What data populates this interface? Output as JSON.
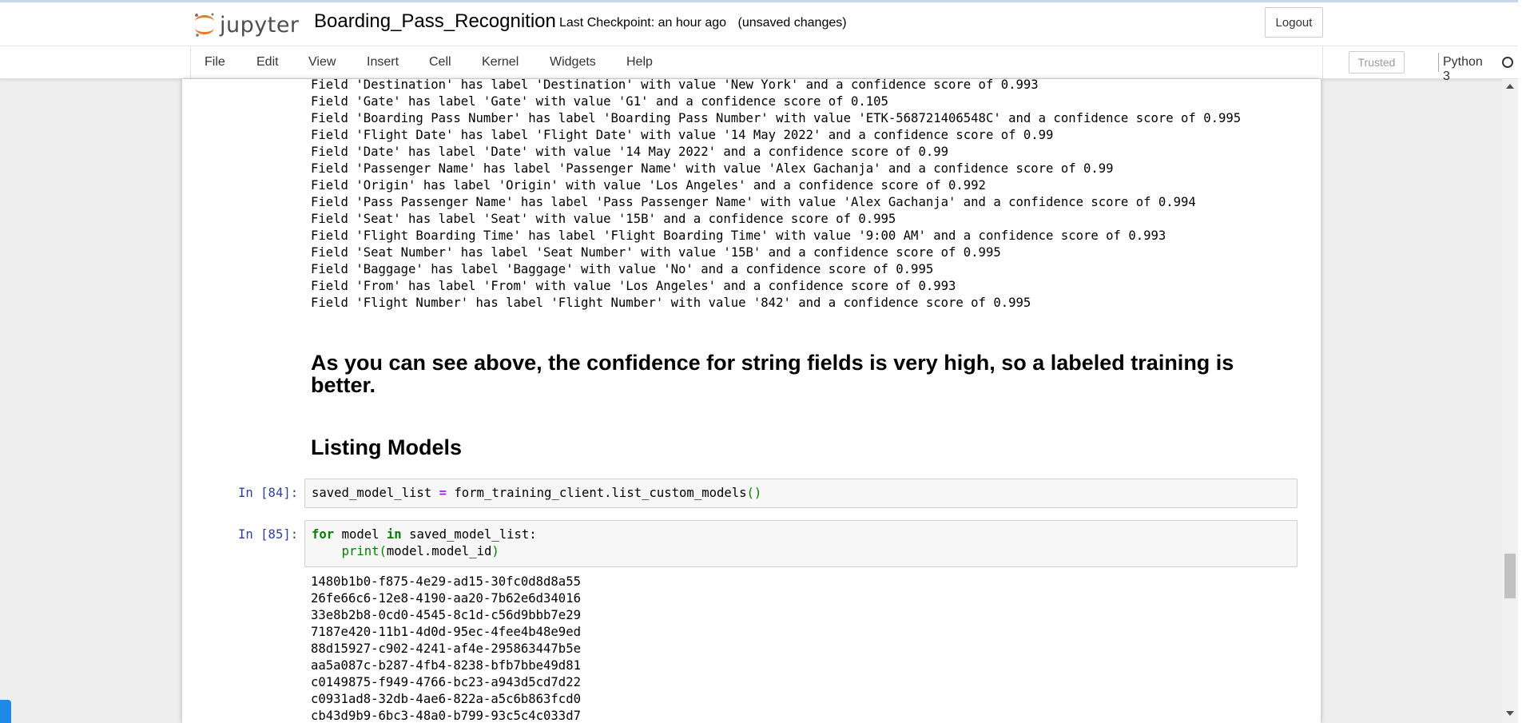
{
  "header": {
    "logo_text": "jupyter",
    "notebook_title": "Boarding_Pass_Recognition",
    "checkpoint_text": "Last Checkpoint: an hour ago",
    "unsaved_text": "(unsaved changes)",
    "logout_label": "Logout"
  },
  "menu": {
    "items": [
      "File",
      "Edit",
      "View",
      "Insert",
      "Cell",
      "Kernel",
      "Widgets",
      "Help"
    ],
    "trusted_label": "Trusted",
    "kernel_label": "Python 3"
  },
  "output_fields": [
    "Field 'Destination' has label 'Destination' with value 'New York' and a confidence score of 0.993",
    "Field 'Gate' has label 'Gate' with value 'G1' and a confidence score of 0.105",
    "Field 'Boarding Pass Number' has label 'Boarding Pass Number' with value 'ETK-568721406548C' and a confidence score of 0.995",
    "Field 'Flight Date' has label 'Flight Date' with value '14 May 2022' and a confidence score of 0.99",
    "Field 'Date' has label 'Date' with value '14 May 2022' and a confidence score of 0.99",
    "Field 'Passenger Name' has label 'Passenger Name' with value 'Alex Gachanja' and a confidence score of 0.99",
    "Field 'Origin' has label 'Origin' with value 'Los Angeles' and a confidence score of 0.992",
    "Field 'Pass Passenger Name' has label 'Pass Passenger Name' with value 'Alex Gachanja' and a confidence score of 0.994",
    "Field 'Seat' has label 'Seat' with value '15B' and a confidence score of 0.995",
    "Field 'Flight Boarding Time' has label 'Flight Boarding Time' with value '9:00 AM' and a confidence score of 0.993",
    "Field 'Seat Number' has label 'Seat Number' with value '15B' and a confidence score of 0.995",
    "Field 'Baggage' has label 'Baggage' with value 'No' and a confidence score of 0.995",
    "Field 'From' has label 'From' with value 'Los Angeles' and a confidence score of 0.993",
    "Field 'Flight Number' has label 'Flight Number' with value '842' and a confidence score of 0.995"
  ],
  "markdown": {
    "note": "As you can see above, the confidence for string fields is very high, so a labeled training is better.",
    "heading": "Listing Models"
  },
  "cell84": {
    "prompt": "In [84]:",
    "var": "saved_model_list",
    "op": "=",
    "call": "form_training_client.list_custom_models",
    "parens": "()"
  },
  "cell85": {
    "prompt": "In [85]:",
    "kw_for": "for",
    "var_model": "model",
    "kw_in": "in",
    "iter": "saved_model_list:",
    "builtin_print": "print",
    "open_paren": "(",
    "arg": "model.model_id",
    "close_paren": ")"
  },
  "model_ids": [
    "1480b1b0-f875-4e29-ad15-30fc0d8d8a55",
    "26fe66c6-12e8-4190-aa20-7b62e6d34016",
    "33e8b2b8-0cd0-4545-8c1d-c56d9bbb7e29",
    "7187e420-11b1-4d0d-95ec-4fee4b48e9ed",
    "88d15927-c902-4241-af4e-295863447b5e",
    "aa5a087c-b287-4fb4-8238-bfb7bbe49d81",
    "c0149875-f949-4766-bc23-a943d5cd7d22",
    "c0931ad8-32db-4ae6-822a-a5c6b863fcd0",
    "cb43d9b9-6bc3-48a0-b799-93c5c4c033d7"
  ],
  "colors": {
    "prompt": "#303f9f",
    "keyword": "#008000",
    "operator": "#aa22ff",
    "logo_orange": "#f37726"
  }
}
